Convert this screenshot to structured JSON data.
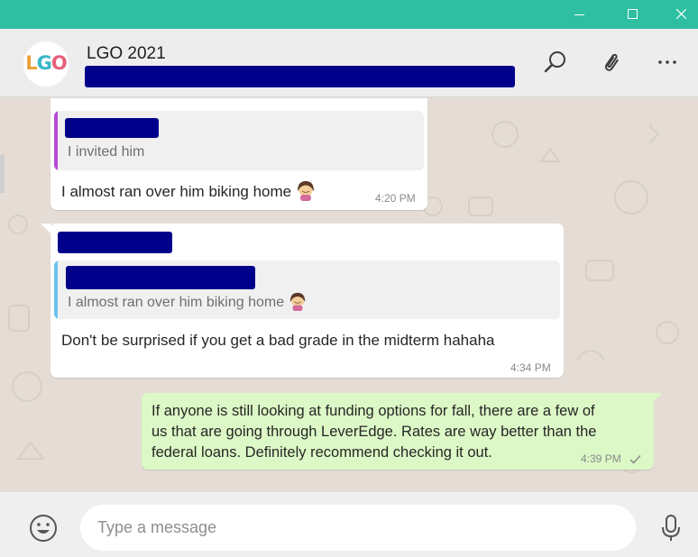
{
  "window": {
    "controls": [
      "minimize-icon",
      "maximize-icon",
      "close-icon"
    ],
    "titlebar_color": "#2ebfa2"
  },
  "header": {
    "avatar_text": [
      "L",
      "G",
      "O"
    ],
    "group_name": "LGO 2021",
    "icons": [
      "search-icon",
      "paperclip-icon",
      "more-options-icon"
    ]
  },
  "messages": [
    {
      "direction": "incoming",
      "quote": {
        "text": "I invited him",
        "accent": "#b44bd6"
      },
      "text": "I almost ran over him biking home",
      "emoji": "woman-facepalming-emoji",
      "time": "4:20 PM"
    },
    {
      "direction": "incoming",
      "quote": {
        "text": "I almost ran over him biking home",
        "accent": "#6cc4ea",
        "emoji": "woman-facepalming-emoji"
      },
      "text": "Don't be surprised if you get a bad grade in the midterm hahaha",
      "time": "4:34 PM"
    },
    {
      "direction": "outgoing",
      "lines": [
        "If anyone is still looking at funding options for fall, there are a few of",
        "us that are going through LeverEdge. Rates are way better than the",
        "federal loans. Definitely recommend checking it out."
      ],
      "time": "4:39 PM",
      "status": "sent-check-icon"
    }
  ],
  "footer": {
    "placeholder": "Type a message",
    "icons": [
      "emoji-icon",
      "microphone-icon"
    ]
  },
  "colors": {
    "incoming_bubble": "#ffffff",
    "outgoing_bubble": "#dcf8c6",
    "chat_background": "#e5ddd5",
    "redaction": "#00008b"
  }
}
